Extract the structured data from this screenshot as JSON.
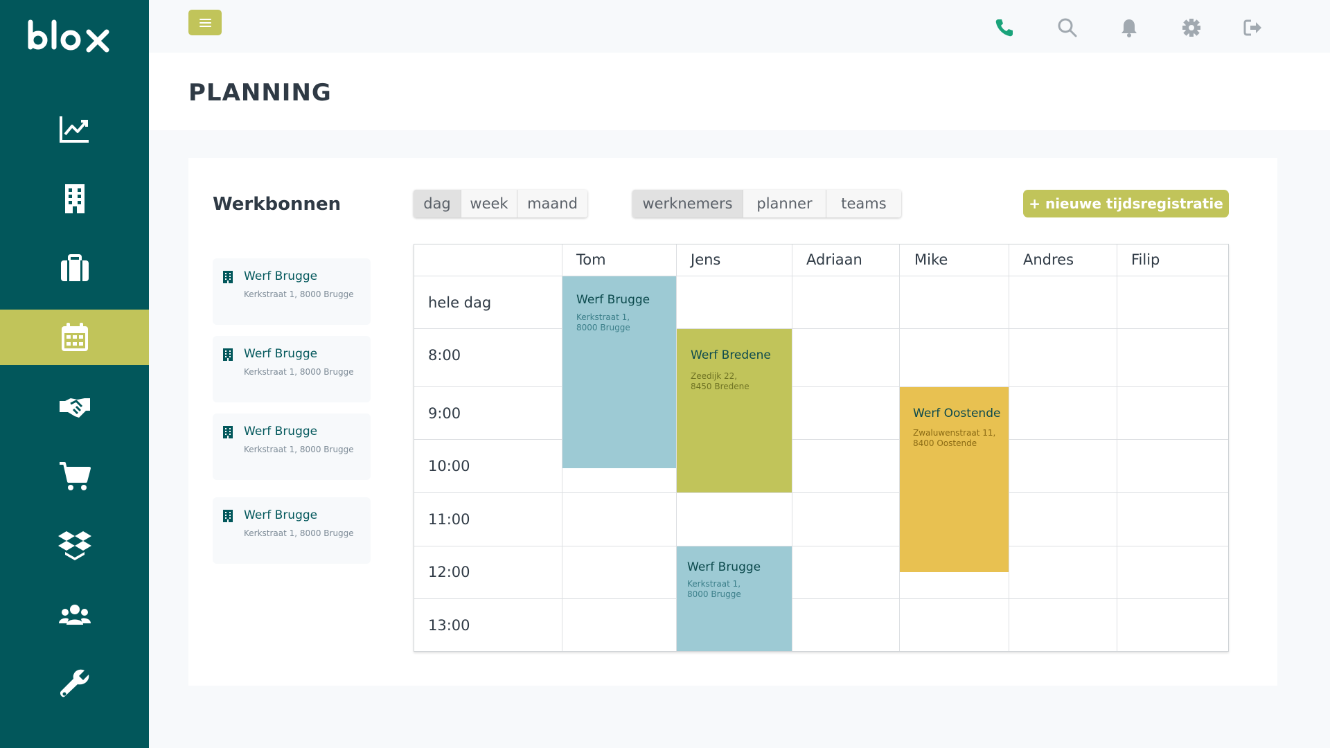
{
  "app": {
    "logo_text": "blox"
  },
  "sidebar": {
    "items": [
      {
        "name": "dashboard",
        "icon": "chart-line-icon",
        "active": false
      },
      {
        "name": "buildings",
        "icon": "building-icon",
        "active": false
      },
      {
        "name": "jobs",
        "icon": "briefcase-icon",
        "active": false
      },
      {
        "name": "planning",
        "icon": "calendar-icon",
        "active": true
      },
      {
        "name": "relations",
        "icon": "handshake-icon",
        "active": false
      },
      {
        "name": "orders",
        "icon": "cart-icon",
        "active": false
      },
      {
        "name": "stock",
        "icon": "boxes-icon",
        "active": false
      },
      {
        "name": "users",
        "icon": "users-icon",
        "active": false
      },
      {
        "name": "settings-tools",
        "icon": "wrench-icon",
        "active": false
      }
    ]
  },
  "topbar": {
    "icons": [
      "phone-icon",
      "search-icon",
      "bell-icon",
      "gear-icon",
      "logout-icon"
    ]
  },
  "page": {
    "title": "PLANNING"
  },
  "workorders": {
    "title": "Werkbonnen",
    "items": [
      {
        "title": "Werf Brugge",
        "address": "Kerkstraat 1, 8000 Brugge"
      },
      {
        "title": "Werf Brugge",
        "address": "Kerkstraat 1, 8000 Brugge"
      },
      {
        "title": "Werf Brugge",
        "address": "Kerkstraat 1, 8000 Brugge"
      },
      {
        "title": "Werf Brugge",
        "address": "Kerkstraat 1, 8000 Brugge"
      }
    ]
  },
  "view_toggle": {
    "options": [
      "dag",
      "week",
      "maand"
    ],
    "selected": "dag"
  },
  "group_toggle": {
    "options": [
      "werknemers",
      "planner",
      "teams"
    ],
    "selected": "werknemers"
  },
  "new_button": {
    "label": "+ nieuwe tijdsregistratie"
  },
  "calendar": {
    "columns": [
      "Tom",
      "Jens",
      "Adriaan",
      "Mike",
      "Andres",
      "Filip"
    ],
    "rows": [
      "hele dag",
      "8:00",
      "9:00",
      "10:00",
      "11:00",
      "12:00",
      "13:00"
    ],
    "events": [
      {
        "employee": "Tom",
        "title": "Werf Brugge",
        "address_line1": "Kerkstraat 1,",
        "address_line2": "8000 Brugge",
        "start": "hele dag",
        "end": "10:30",
        "color": "#9dcad4"
      },
      {
        "employee": "Jens",
        "title": "Werf Bredene",
        "address_line1": "Zeedijk 22,",
        "address_line2": "8450 Bredene",
        "start": "8:00",
        "end": "11:00",
        "color": "#c1c45a"
      },
      {
        "employee": "Jens",
        "title": "Werf Brugge",
        "address_line1": "Kerkstraat 1,",
        "address_line2": "8000 Brugge",
        "start": "12:00",
        "end": "14:00",
        "color": "#9dcad4"
      },
      {
        "employee": "Mike",
        "title": "Werf Oostende",
        "address_line1": "Zwaluwenstraat 11,",
        "address_line2": "8400 Oostende",
        "start": "9:00",
        "end": "12:30",
        "color": "#e8c151"
      }
    ]
  }
}
